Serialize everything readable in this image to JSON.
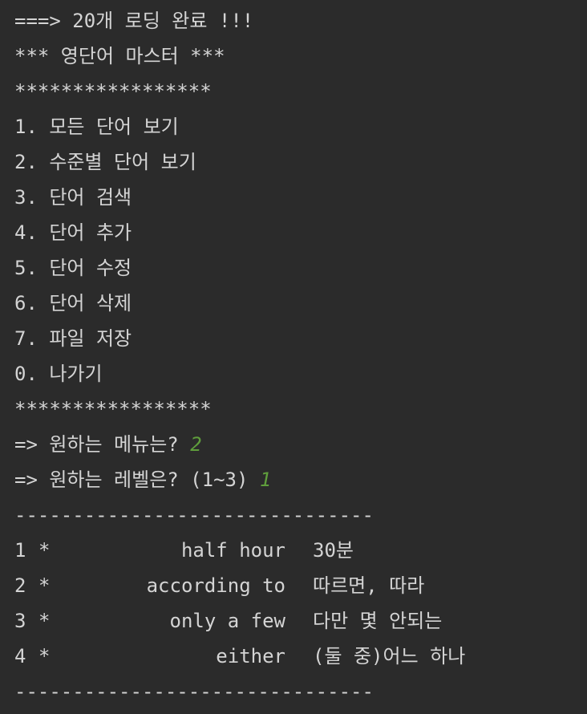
{
  "console": {
    "loading_msg": "===> 20개 로딩 완료 !!!",
    "title": "*** 영단어 마스터 ***",
    "separator_stars": "*****************",
    "menu_items": [
      "1. 모든 단어 보기",
      "2. 수준별 단어 보기",
      "3. 단어 검색",
      "4. 단어 추가",
      "5. 단어 수정",
      "6. 단어 삭제",
      "7. 파일 저장",
      "0. 나가기"
    ],
    "prompt_menu": "=> 원하는 메뉴는? ",
    "input_menu": "2",
    "prompt_level": "=> 원하는 레벨은? (1~3) ",
    "input_level": "1",
    "dashes": "-------------------------------",
    "words": [
      {
        "num": "1",
        "star": "*",
        "english": "half hour",
        "korean": "30분"
      },
      {
        "num": "2",
        "star": "*",
        "english": "according to",
        "korean": "따르면, 따라"
      },
      {
        "num": "3",
        "star": "*",
        "english": "only a few",
        "korean": "다만 몇 안되는"
      },
      {
        "num": "4",
        "star": "*",
        "english": "either",
        "korean": "(둘 중)어느 하나"
      }
    ]
  },
  "colors": {
    "background": "#2b2b2b",
    "text": "#d4d4d4",
    "user_input": "#5f9e3c"
  }
}
